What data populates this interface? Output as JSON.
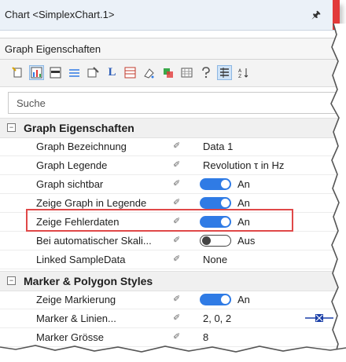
{
  "window": {
    "title": "Chart <SimplexChart.1>"
  },
  "section_bar": {
    "label": "Graph Eigenschaften"
  },
  "toolbar": {
    "icons": [
      "new-icon",
      "chart-icon",
      "bar-icon",
      "legend-icon",
      "properties-icon",
      "axis-L-icon",
      "grid-icon",
      "paint-icon",
      "format-icon",
      "table-icon",
      "help-icon",
      "categorize-icon",
      "sort-az-icon"
    ]
  },
  "search": {
    "placeholder": "Suche"
  },
  "categories": [
    {
      "label": "Graph Eigenschaften",
      "toggle": "−",
      "props": [
        {
          "name": "Graph Bezeichnung",
          "value": "Data 1"
        },
        {
          "name": "Graph Legende",
          "value": "Revolution τ in Hz"
        },
        {
          "name": "Graph sichtbar",
          "toggle": "on",
          "value": "An"
        },
        {
          "name": "Zeige Graph in Legende",
          "toggle": "on",
          "value": "An"
        },
        {
          "name": "Zeige Fehlerdaten",
          "toggle": "on",
          "value": "An"
        },
        {
          "name": "Bei automatischer Skali...",
          "toggle": "off",
          "value": "Aus"
        },
        {
          "name": "Linked SampleData",
          "value": "None"
        }
      ]
    },
    {
      "label": "Marker & Polygon Styles",
      "toggle": "−",
      "props": [
        {
          "name": "Zeige Markierung",
          "toggle": "on",
          "value": "An"
        },
        {
          "name": "Marker & Linien...",
          "value": "2, 0, 2"
        },
        {
          "name": "Marker Grösse",
          "value": "8"
        }
      ]
    }
  ],
  "colors": {
    "accent": "#2f7be5",
    "highlight": "#e04848"
  }
}
